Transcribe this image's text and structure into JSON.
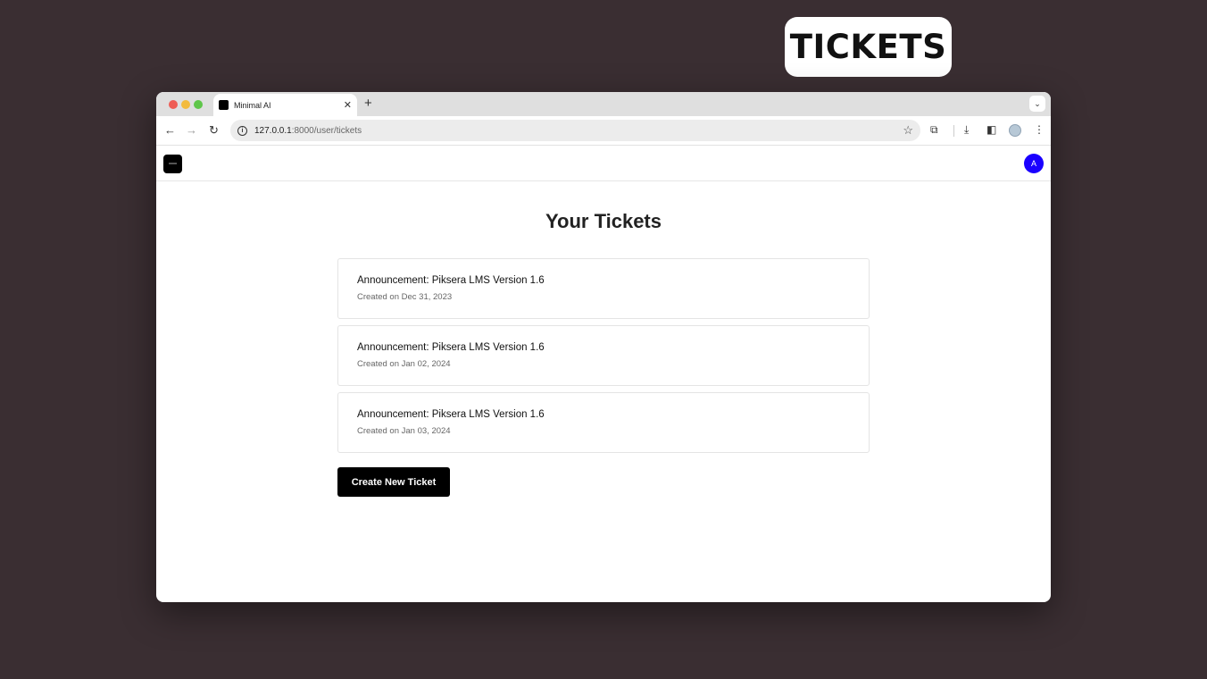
{
  "badge": {
    "text": "TICKETS"
  },
  "browser": {
    "tab": {
      "title": "Minimal AI"
    },
    "url": {
      "host": "127.0.0.1",
      "path": ":8000/user/tickets"
    }
  },
  "site": {
    "avatar_letter": "A",
    "page_title": "Your Tickets",
    "tickets": [
      {
        "title": "Announcement: Piksera LMS Version 1.6",
        "date": "Created on Dec 31, 2023"
      },
      {
        "title": "Announcement: Piksera LMS Version 1.6",
        "date": "Created on Jan 02, 2024"
      },
      {
        "title": "Announcement: Piksera LMS Version 1.6",
        "date": "Created on Jan 03, 2024"
      }
    ],
    "create_button": "Create New Ticket"
  },
  "colors": {
    "background": "#3a2e32",
    "avatar": "#1a00ff",
    "button": "#000000"
  }
}
